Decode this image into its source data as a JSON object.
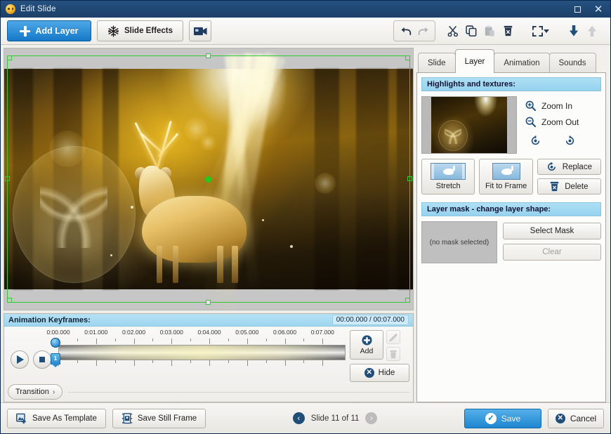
{
  "window": {
    "title": "Edit Slide",
    "icon": "app-icon",
    "maximize_label": "",
    "close_label": "✕"
  },
  "toolbar": {
    "add_layer_label": "Add Layer",
    "slide_effects_label": "Slide Effects",
    "video_label": "",
    "icons": [
      {
        "name": "undo-icon",
        "enabled": true
      },
      {
        "name": "redo-icon",
        "enabled": false
      },
      {
        "name": "cut-icon",
        "enabled": true
      },
      {
        "name": "copy-icon",
        "enabled": true
      },
      {
        "name": "paste-icon",
        "enabled": false
      },
      {
        "name": "delete-icon",
        "enabled": true
      },
      {
        "name": "fit-screen-icon",
        "enabled": true
      },
      {
        "name": "move-down-icon",
        "enabled": true
      },
      {
        "name": "move-up-icon",
        "enabled": false
      }
    ]
  },
  "stage": {
    "scene": "golden forest deer with sun rays",
    "selection": "layer selection handles",
    "center_marker": "layer center point"
  },
  "keyframes": {
    "title": "Animation Keyframes:",
    "time_display": "00:00.000 / 00:07.000",
    "current_time": "00:00.000",
    "total_time": "00:07.000",
    "playhead_label": "1",
    "tick_labels": [
      "0:00.000",
      "0:01.000",
      "0:02.000",
      "0:03.000",
      "0:04.000",
      "0:05.000",
      "0:06.000",
      "0:07.000"
    ],
    "play_label": "",
    "stop_label": "",
    "add_label": "Add",
    "edit_label": "",
    "delete_label": "",
    "transition_label": "Transition",
    "transition_chevron": "›",
    "hide_label": "Hide"
  },
  "right_panel": {
    "tabs": [
      {
        "label": "Slide",
        "active": false
      },
      {
        "label": "Layer",
        "active": true
      },
      {
        "label": "Animation",
        "active": false
      },
      {
        "label": "Sounds",
        "active": false
      }
    ],
    "highlights": {
      "section_title": "Highlights and textures:",
      "zoom_in_label": "Zoom In",
      "zoom_out_label": "Zoom Out",
      "rotate_left_label": "",
      "rotate_right_label": "",
      "stretch_label": "Stretch",
      "fit_to_frame_label": "Fit to Frame",
      "replace_label": "Replace",
      "delete_label": "Delete"
    },
    "mask": {
      "section_title": "Layer mask - change layer shape:",
      "empty_text": "(no mask selected)",
      "select_mask_label": "Select Mask",
      "clear_label": "Clear"
    }
  },
  "bottom_bar": {
    "save_as_template_label": "Save As Template",
    "save_still_frame_label": "Save Still Frame",
    "slide_counter": "Slide 11 of 11",
    "prev_label": "‹",
    "next_label": "›",
    "save_label": "Save",
    "cancel_label": "Cancel"
  },
  "colors": {
    "titlebar": "#255181",
    "accent_blue": "#1e86cf",
    "section_header": "#96d2ee",
    "selection_green": "#2ecc2e",
    "icon_navy": "#1f4e79"
  }
}
